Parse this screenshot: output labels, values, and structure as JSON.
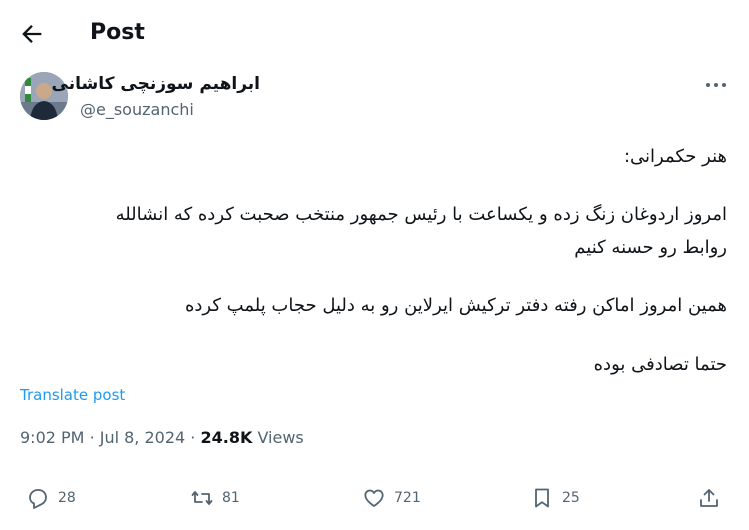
{
  "header": {
    "title": "Post"
  },
  "author": {
    "name": "ابراهیم سوزنچی کاشانی",
    "handle": "@e_souzanchi"
  },
  "post": {
    "lines": [
      "هنر حکمرانی:",
      "امروز اردوغان زنگ زده و یکساعت با رئیس جمهور منتخب صحبت کرده که انشالله",
      "روابط رو حسنه کنیم",
      "همین امروز اماکن رفته دفتر ترکیش ایرلاین رو به دلیل حجاب پلمپ کرده",
      "حتما تصادفی بوده"
    ],
    "translate_label": "Translate post",
    "time": "9:02 PM",
    "date": "Jul 8, 2024",
    "views_count": "24.8K",
    "views_label": "Views"
  },
  "actions": {
    "replies": "28",
    "reposts": "81",
    "likes": "721",
    "bookmarks": "25"
  },
  "icons": {
    "back": "back-arrow-icon",
    "more": "more-icon",
    "reply": "reply-icon",
    "repost": "repost-icon",
    "like": "heart-icon",
    "bookmark": "bookmark-icon",
    "share": "share-icon"
  },
  "colors": {
    "link": "#1d9bf0",
    "muted": "#536471",
    "text": "#0f1419"
  }
}
